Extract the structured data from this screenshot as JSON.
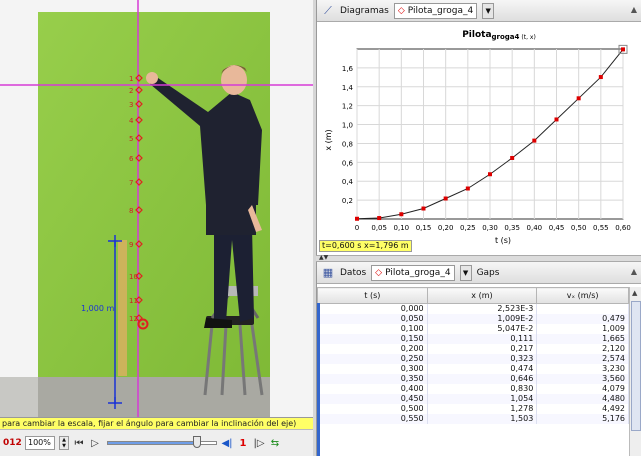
{
  "video": {
    "calibration_label": "1,000 m",
    "point_labels": [
      "1",
      "2",
      "3",
      "4",
      "5",
      "6",
      "7",
      "8",
      "9",
      "10",
      "11",
      "12"
    ],
    "status_text": "para cambiar la escala, fijar el ángulo para cambiar la inclinación del eje)",
    "frame_number": "012",
    "zoom": "100%",
    "step_number": "1",
    "slider_fraction": 0.85
  },
  "diagram": {
    "tab_label": "Diagramas",
    "track_name": "Pilota_groga_4",
    "readout": "t=0,600 s  x=1,796 m"
  },
  "table_panel": {
    "tab_label": "Datos",
    "track_name": "Pilota_groga_4",
    "gaps_label": "Gaps",
    "headers": [
      "t (s)",
      "x (m)",
      "vₓ (m/s)"
    ],
    "rows": [
      [
        "0,000",
        "2,523E-3",
        ""
      ],
      [
        "0,050",
        "1,009E-2",
        "0,479"
      ],
      [
        "0,100",
        "5,047E-2",
        "1,009"
      ],
      [
        "0,150",
        "0,111",
        "1,665"
      ],
      [
        "0,200",
        "0,217",
        "2,120"
      ],
      [
        "0,250",
        "0,323",
        "2,574"
      ],
      [
        "0,300",
        "0,474",
        "3,230"
      ],
      [
        "0,350",
        "0,646",
        "3,560"
      ],
      [
        "0,400",
        "0,830",
        "4,079"
      ],
      [
        "0,450",
        "1,054",
        "4,480"
      ],
      [
        "0,500",
        "1,278",
        "4,492"
      ],
      [
        "0,550",
        "1,503",
        "5,176"
      ]
    ]
  },
  "chart_data": {
    "type": "scatter",
    "title": "Pilota",
    "title_subscript": "groga4",
    "title_suffix": "(t, x)",
    "xlabel": "t (s)",
    "ylabel": "x (m)",
    "xlim": [
      0,
      0.6
    ],
    "ylim": [
      0,
      1.8
    ],
    "x_ticks": [
      "0",
      "0,05",
      "0,10",
      "0,15",
      "0,20",
      "0,25",
      "0,30",
      "0,35",
      "0,40",
      "0,45",
      "0,50",
      "0,55",
      "0,60"
    ],
    "y_ticks": [
      "0,2",
      "0,4",
      "0,6",
      "0,8",
      "1,0",
      "1,2",
      "1,4",
      "1,6"
    ],
    "grid": true,
    "marker_color": "#dd0000",
    "x": [
      0.0,
      0.05,
      0.1,
      0.15,
      0.2,
      0.25,
      0.3,
      0.35,
      0.4,
      0.45,
      0.5,
      0.55,
      0.6
    ],
    "y": [
      0.0025,
      0.0101,
      0.0505,
      0.111,
      0.217,
      0.323,
      0.474,
      0.646,
      0.83,
      1.054,
      1.278,
      1.503,
      1.796
    ]
  },
  "colors": {
    "green_screen": "#8cc63f",
    "crosshair": "#d63bd6",
    "track_marker": "#e02020",
    "readout_bg": "#ffff66"
  }
}
